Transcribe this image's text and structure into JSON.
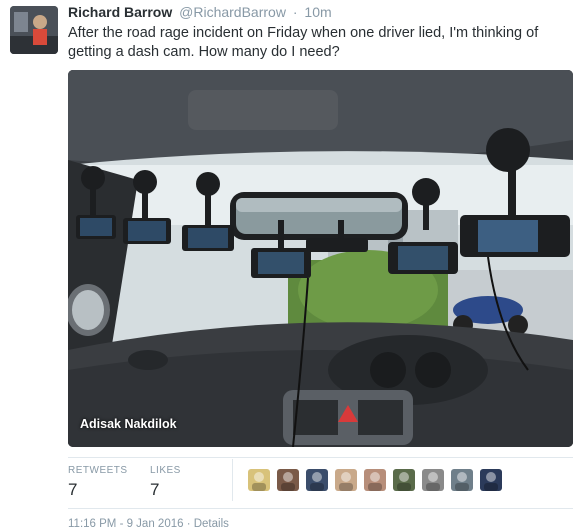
{
  "tweet": {
    "author_name": "Richard Barrow",
    "author_handle": "@RichardBarrow",
    "separator": "·",
    "time_ago": "10m",
    "text": "After the road rage incident on Friday when one driver lied, I'm thinking of getting a dash cam. How many do I need?",
    "photo_credit": "Adisak Nakdilok"
  },
  "stats": {
    "retweets_label": "RETWEETS",
    "retweets_value": "7",
    "likes_label": "LIKES",
    "likes_value": "7"
  },
  "likers": [
    {
      "icon": "avatar-1",
      "color": "#d8c27a"
    },
    {
      "icon": "avatar-2",
      "color": "#7a5a48"
    },
    {
      "icon": "avatar-3",
      "color": "#3b4d6b"
    },
    {
      "icon": "avatar-4",
      "color": "#c9a98a"
    },
    {
      "icon": "avatar-5",
      "color": "#b78e7a"
    },
    {
      "icon": "avatar-6",
      "color": "#5a6b4a"
    },
    {
      "icon": "avatar-7",
      "color": "#8a8a8a"
    },
    {
      "icon": "avatar-8",
      "color": "#6f7f8a"
    },
    {
      "icon": "avatar-9",
      "color": "#2b3a5a"
    }
  ],
  "footer": {
    "text": "11:16 PM - 9 Jan 2016 · Details"
  }
}
